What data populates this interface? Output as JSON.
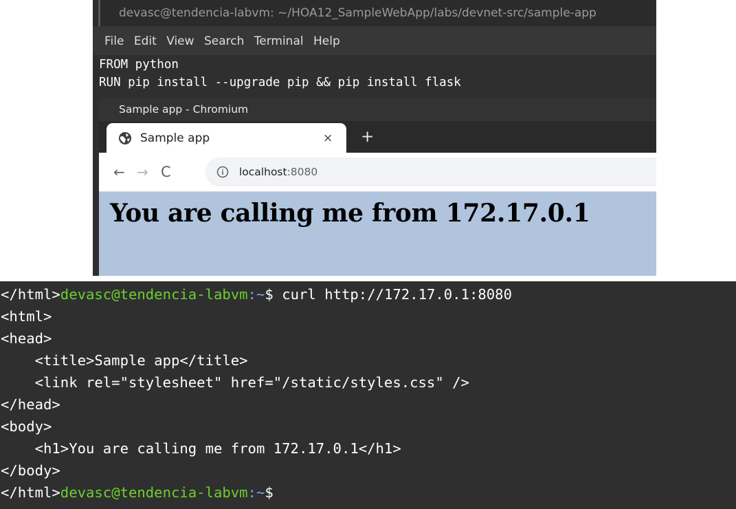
{
  "terminal_top": {
    "title": "devasc@tendencia-labvm: ~/HOA12_SampleWebApp/labs/devnet-src/sample-app",
    "menu": [
      "File",
      "Edit",
      "View",
      "Search",
      "Terminal",
      "Help"
    ],
    "lines": [
      "FROM python",
      "RUN pip install --upgrade pip && pip install flask"
    ]
  },
  "chromium": {
    "window_title": "Sample app - Chromium",
    "tab": {
      "title": "Sample app",
      "close": "×",
      "icon": "globe-icon"
    },
    "new_tab": "+",
    "nav": {
      "back": "←",
      "forward": "→",
      "reload": "C"
    },
    "url_host": "localhost",
    "url_port": ":8080",
    "page_heading": "You are calling me from 172.17.0.1",
    "page_background": "#b0c4de"
  },
  "terminal_bottom": {
    "first_line": {
      "prefix": "</html>",
      "user_host": "devasc@tendencia-labvm",
      "path": ":~",
      "symbol": "$ ",
      "command": "curl http://172.17.0.1:8080"
    },
    "output": [
      "<html>",
      "<head>",
      "    <title>Sample app</title>",
      "    <link rel=\"stylesheet\" href=\"/static/styles.css\" />",
      "</head>",
      "<body>",
      "    <h1>You are calling me from 172.17.0.1</h1>",
      "</body>"
    ],
    "last_line": {
      "prefix": "</html>",
      "user_host": "devasc@tendencia-labvm",
      "path": ":~",
      "symbol": "$"
    },
    "colors": {
      "user_host": "#6bd02e",
      "path": "#7aa7e0",
      "background": "#2f2f2f"
    }
  }
}
